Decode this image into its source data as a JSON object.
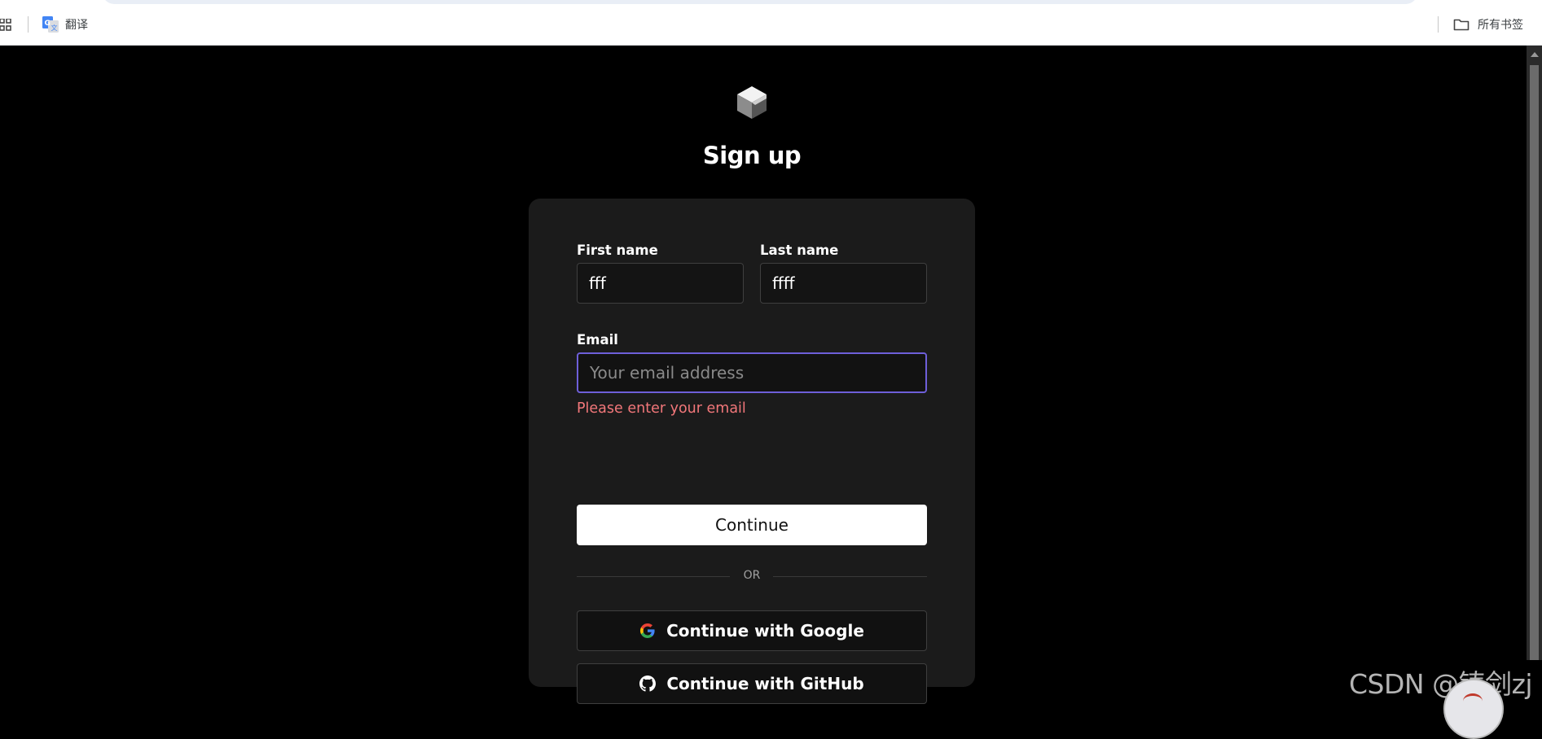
{
  "bookmarks_bar": {
    "items": [
      {
        "label": "翻译",
        "icon": "google-translate-icon"
      }
    ],
    "all_bookmarks": {
      "label": "所有书签",
      "icon": "folder-icon"
    }
  },
  "page": {
    "logo_icon": "cube-logo-icon",
    "title": "Sign up"
  },
  "form": {
    "first_name": {
      "label": "First name",
      "value": "fff"
    },
    "last_name": {
      "label": "Last name",
      "value": "ffff"
    },
    "email": {
      "label": "Email",
      "value": "",
      "placeholder": "Your email address",
      "error": "Please enter your email"
    },
    "continue_label": "Continue",
    "divider_text": "OR",
    "google_label": "Continue with Google",
    "github_label": "Continue with GitHub"
  },
  "watermark": "CSDN @铸剑zj",
  "colors": {
    "background": "#000000",
    "card": "#1b1b1b",
    "focus_border": "#6e5fd9",
    "error": "#f2777a",
    "primary_button": "#ffffff"
  }
}
